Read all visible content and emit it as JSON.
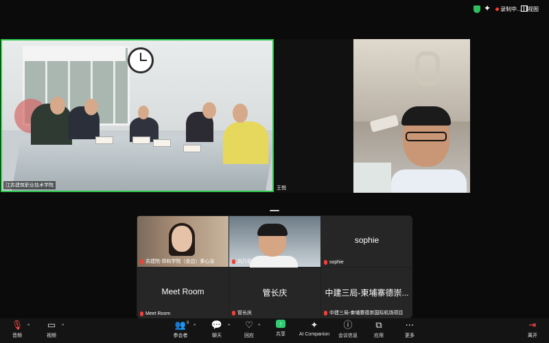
{
  "topbar": {
    "recording_label": "录制中...",
    "view_label": "视图",
    "icons": [
      "shield-icon",
      "sparkle-icon",
      "recording-dot-icon",
      "grid-view-icon"
    ]
  },
  "video_tiles": {
    "main_room": {
      "name": "江苏建筑职业技术学院",
      "highlight_color": "#2fcb4f"
    },
    "wang_yue": {
      "name": "王悦"
    }
  },
  "gallery": {
    "tiles": [
      {
        "name": "苏建院-郑和学院（金边）秦心洁"
      },
      {
        "name": "刘乃臣"
      },
      {
        "name": "sophie",
        "center_name": "sophie"
      },
      {
        "name": "Meet Room",
        "center_name": "Meet Room"
      },
      {
        "name": "管长庆",
        "center_name": "管长庆"
      },
      {
        "name": "中建三局-柬埔寨德崇国际机场项目",
        "center_name": "中建三局-柬埔寨德崇..."
      }
    ]
  },
  "toolbar": {
    "audio_label": "音频",
    "video_label": "视频",
    "participants_label": "参会者",
    "participants_count": "8",
    "chat_label": "聊天",
    "react_label": "回应",
    "share_label": "共享",
    "ai_label": "AI Companion",
    "info_label": "会议信息",
    "apps_label": "应用",
    "more_label": "更多",
    "leave_label": "离开",
    "share_color": "#2ecc71",
    "leave_color": "#ff4d4d"
  }
}
